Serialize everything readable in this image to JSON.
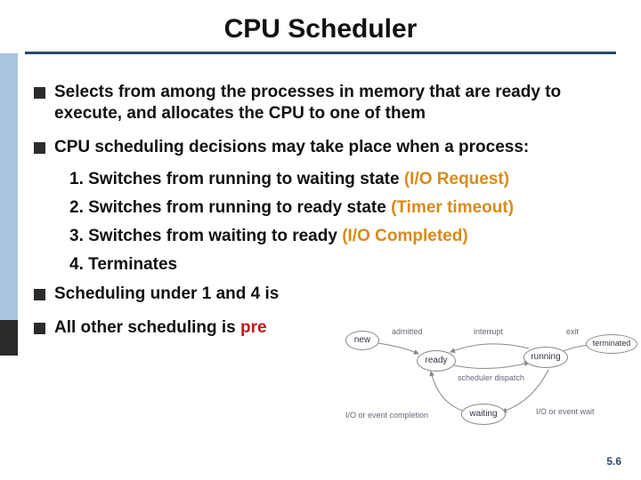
{
  "title": "CPU Scheduler",
  "bullets": [
    {
      "text": "Selects from among the processes in memory that are ready to execute, and allocates the CPU to one of them"
    },
    {
      "text": "CPU scheduling decisions may take place when a process:"
    }
  ],
  "numbered": [
    {
      "n": "1.",
      "lead": " Switches from running to waiting state ",
      "highlight": "(I/O Request)",
      "hclass": "orange"
    },
    {
      "n": "2.",
      "lead": " Switches from running to ready state ",
      "highlight": "(Timer timeout)",
      "hclass": "orange"
    },
    {
      "n": "3.",
      "lead": " Switches from waiting to ready ",
      "highlight": "(I/O Completed)",
      "hclass": "orange"
    },
    {
      "n": "4.",
      "lead": " Terminates",
      "highlight": "",
      "hclass": ""
    }
  ],
  "bullets2": [
    {
      "prefix": "Scheduling under 1 and 4 is",
      "highlight": "",
      "hclass": ""
    },
    {
      "prefix": "All other scheduling is ",
      "highlight": "pre",
      "hclass": "red"
    }
  ],
  "diagram": {
    "states": {
      "new": "new",
      "ready": "ready",
      "running": "running",
      "waiting": "waiting",
      "terminated": "terminated"
    },
    "labels": {
      "admitted": "admitted",
      "interrupt": "interrupt",
      "exit": "exit",
      "dispatch": "scheduler dispatch",
      "io_done": "I/O or event completion",
      "io_wait": "I/O or event wait"
    }
  },
  "page": "5.6"
}
